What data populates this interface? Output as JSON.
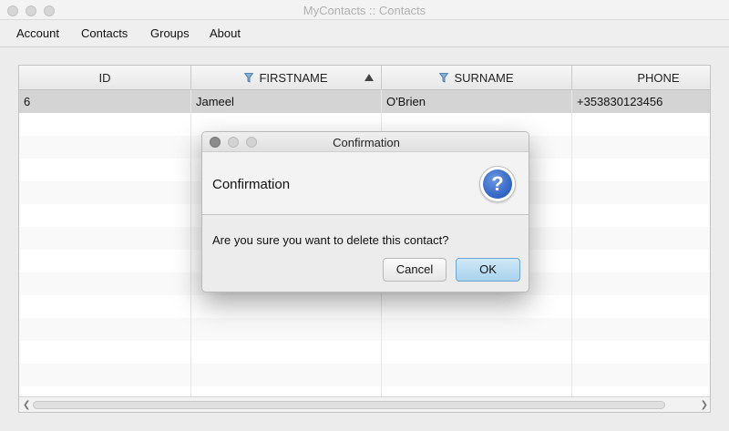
{
  "window": {
    "title": "MyContacts :: Contacts"
  },
  "menu": {
    "items": [
      "Account",
      "Contacts",
      "Groups",
      "About"
    ]
  },
  "table": {
    "columns": [
      "ID",
      "FIRSTNAME",
      "SURNAME",
      "PHONE"
    ],
    "sort": {
      "column": "FIRSTNAME",
      "direction": "ascending"
    },
    "rows": [
      {
        "id": "6",
        "firstname": "Jameel",
        "surname": "O'Brien",
        "phone": "+353830123456"
      }
    ]
  },
  "dialog": {
    "title": "Confirmation",
    "header": "Confirmation",
    "message": "Are you sure you want to delete this contact?",
    "cancel_label": "Cancel",
    "ok_label": "OK",
    "icon": "question-icon",
    "icon_glyph": "?"
  },
  "colors": {
    "selected_row": "#d4d4d4",
    "ok_button": "#a9d3ee",
    "question_icon": "#2f62c6"
  }
}
